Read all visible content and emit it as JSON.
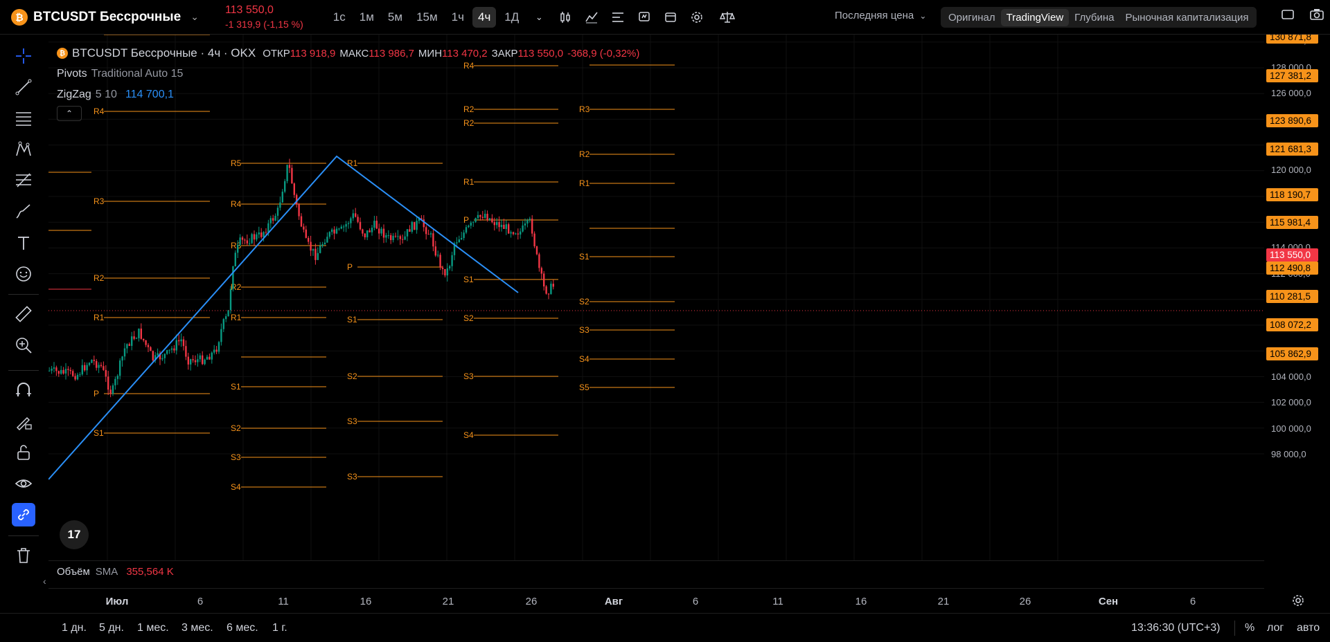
{
  "header": {
    "symbol": "BTCUSDT Бессрочные",
    "coin_letter": "₿",
    "price": "113 550,0",
    "change": "-1 319,9 (-1,15 %)",
    "intervals": [
      "1с",
      "1м",
      "5м",
      "15м",
      "1ч",
      "4ч",
      "1Д"
    ],
    "active_interval": "4ч",
    "last_price_label": "Последняя цена",
    "view_tabs": [
      "Оригинал",
      "TradingView",
      "Глубина",
      "Рыночная капитализация"
    ],
    "active_view": "TradingView",
    "colors": {
      "accent": "#2962ff",
      "down": "#f23645",
      "up": "#089981",
      "pivot": "#f7931a",
      "zigzag": "#2a8ff7"
    }
  },
  "legend": {
    "title": "BTCUSDT Бессрочные · 4ч · OKX",
    "open_label": "ОТКР",
    "open": "113 918,9",
    "high_label": "МАКС",
    "high": "113 986,7",
    "low_label": "МИН",
    "low": "113 470,2",
    "close_label": "ЗАКР",
    "close": "113 550,0",
    "change": "-368,9 (-0,32%)",
    "pivots_name": "Pivots",
    "pivots_params": "Traditional Auto 15",
    "zigzag_name": "ZigZag",
    "zigzag_params": "5 10",
    "zigzag_value": "114 700,1"
  },
  "tv_logo": "17",
  "price_axis": {
    "ticks": [
      "128 000,0",
      "126 000,0",
      "120 000,0",
      "114 000,0",
      "112 000,0",
      "104 000,0",
      "102 000,0",
      "100 000,0",
      "98 000,0"
    ],
    "top_partial": "128 000,0",
    "labels": [
      {
        "text": "130 871,8",
        "kind": "pivot"
      },
      {
        "text": "127 381,2",
        "kind": "pivot"
      },
      {
        "text": "123 890,6",
        "kind": "pivot"
      },
      {
        "text": "121 681,3",
        "kind": "pivot"
      },
      {
        "text": "118 190,7",
        "kind": "pivot"
      },
      {
        "text": "115 981,4",
        "kind": "pivot"
      },
      {
        "text": "113 550,0",
        "kind": "last"
      },
      {
        "text": "112 490,8",
        "kind": "pivot"
      },
      {
        "text": "110 281,5",
        "kind": "pivot"
      },
      {
        "text": "108 072,2",
        "kind": "pivot"
      },
      {
        "text": "105 862,9",
        "kind": "pivot"
      }
    ]
  },
  "pivot_labels": [
    "R4",
    "R3",
    "R2",
    "R1",
    "P",
    "S1",
    "R5",
    "R4",
    "R3",
    "R2",
    "R1",
    "S1",
    "S2",
    "S3",
    "S4",
    "R1",
    "P",
    "S1",
    "S2",
    "S3",
    "R3",
    "R2",
    "R1",
    "P",
    "S1",
    "S2",
    "S3",
    "S4",
    "R4",
    "R3",
    "R2",
    "R1",
    "S1",
    "S2",
    "S3",
    "S4",
    "S5"
  ],
  "volume": {
    "label": "Объём",
    "ma": "SMA",
    "value": "355,564 K"
  },
  "time_axis": [
    "Июл",
    "6",
    "11",
    "16",
    "21",
    "26",
    "Авг",
    "6",
    "11",
    "16",
    "21",
    "26",
    "Сен",
    "6"
  ],
  "bottom": {
    "ranges": [
      "1 дн.",
      "5 дн.",
      "1 мес.",
      "3 мес.",
      "6 мес.",
      "1 г."
    ],
    "clock": "13:36:30 (UTC+3)",
    "percent": "%",
    "log": "лог",
    "auto": "авто"
  }
}
